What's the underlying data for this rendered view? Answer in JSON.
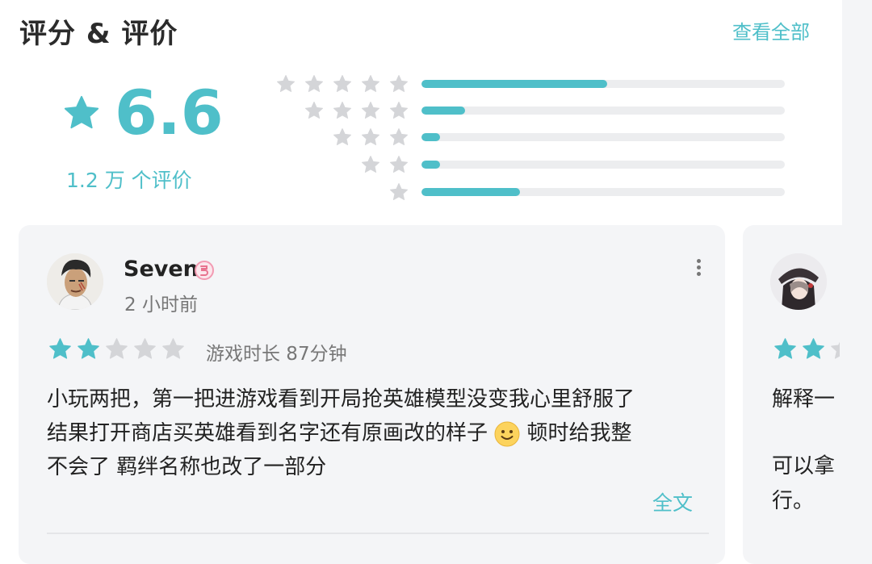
{
  "header": {
    "title": "评分 & 评价",
    "view_all_label": "查看全部"
  },
  "summary": {
    "score": "6.6",
    "review_count_text": "1.2 万 个评价",
    "star_icon": "star-icon",
    "accent_color": "#4fbfc9"
  },
  "distribution": [
    {
      "stars": 5,
      "fraction": 0.51
    },
    {
      "stars": 4,
      "fraction": 0.12
    },
    {
      "stars": 3,
      "fraction": 0.05
    },
    {
      "stars": 2,
      "fraction": 0.05
    },
    {
      "stars": 1,
      "fraction": 0.27
    }
  ],
  "reviews": [
    {
      "username": "Seven",
      "badge_icon": "level-badge-icon",
      "time_ago": "2 小时前",
      "rating": 2,
      "playtime": "游戏时长 87分钟",
      "text_line1": "小玩两把，第一把进游戏看到开局抢英雄模型没变我心里舒服了",
      "text_line2a": "结果打开商店买英雄看到名字还有原画改的样子",
      "text_line2b": "顿时给我整",
      "text_line3": "不会了 羁绊名称也改了一部分",
      "full_text_label": "全文"
    },
    {
      "rating": 2,
      "text_line1": "解释一",
      "text_line2": "可以拿",
      "text_line3": "行。"
    }
  ]
}
